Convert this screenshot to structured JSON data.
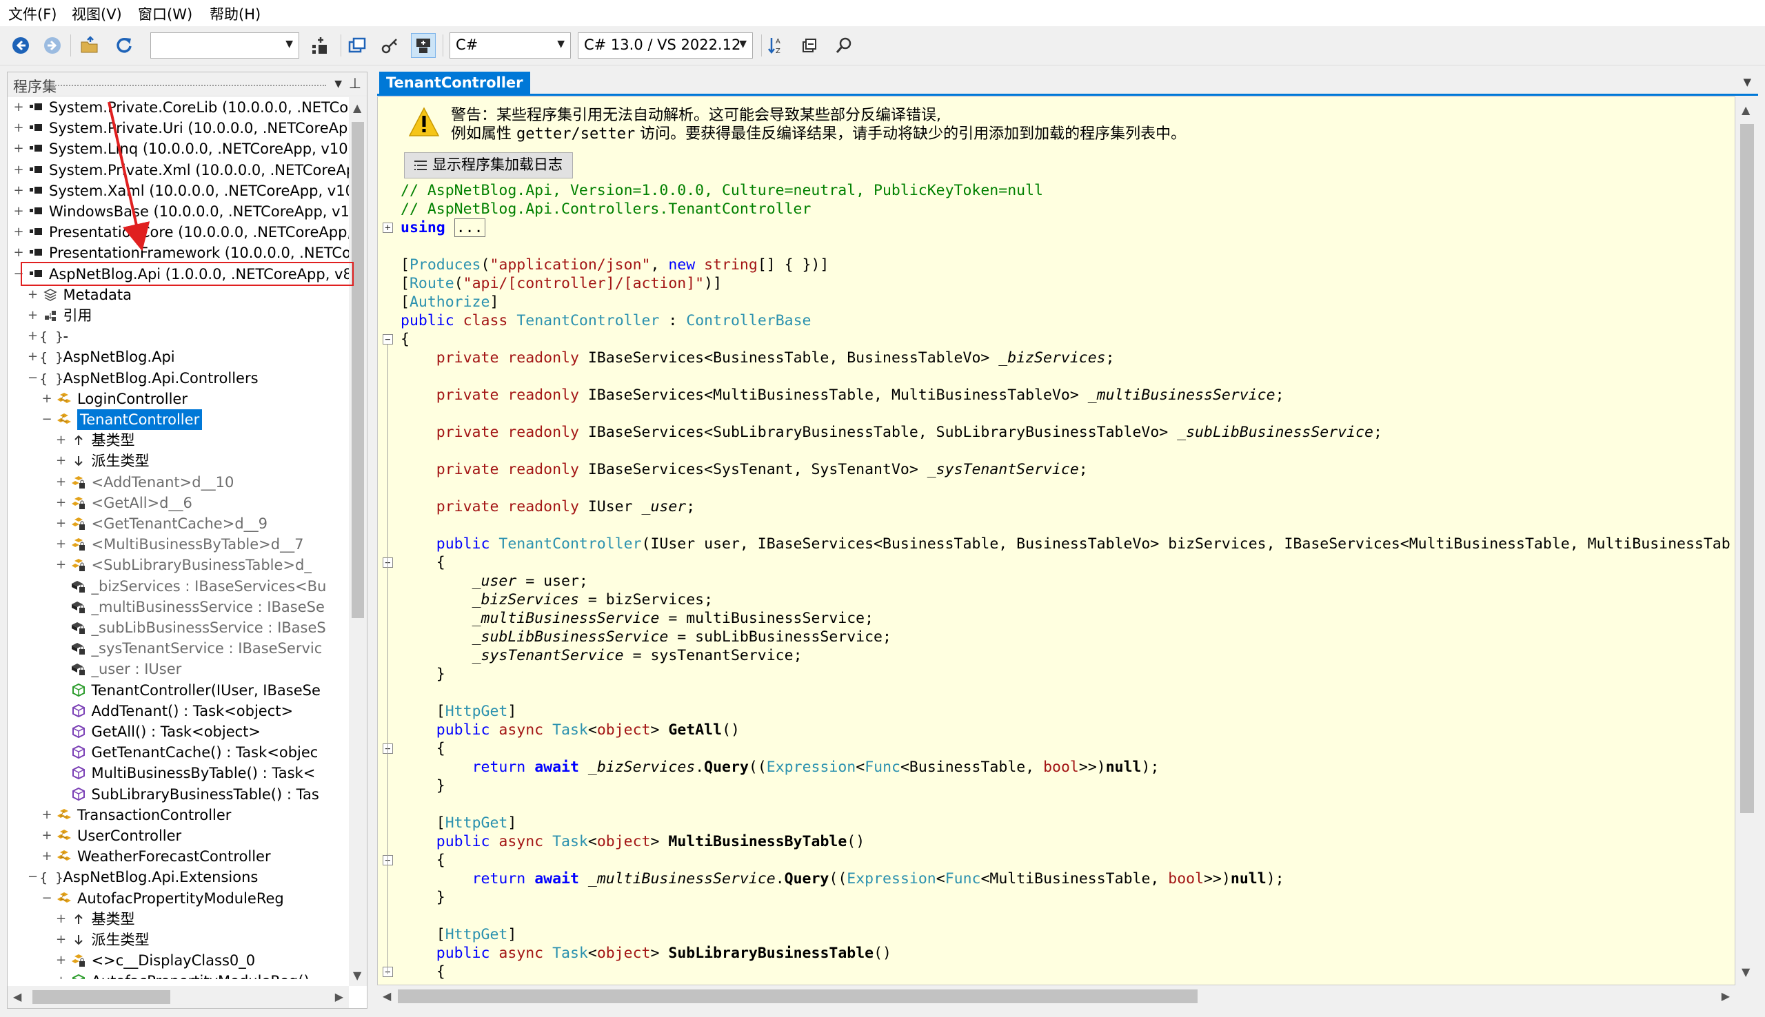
{
  "menu": [
    "文件(F)",
    "视图(V)",
    "窗口(W)",
    "帮助(H)"
  ],
  "toolbar": {
    "search_combo_value": "",
    "language": "C#",
    "language_version": "C# 13.0 / VS 2022.12",
    "buttons": [
      "back-icon",
      "forward-icon",
      "open-icon",
      "reload-icon",
      "add-to-list-icon",
      "manage-lists-icon",
      "show-all-icon",
      "show-private-icon",
      "sort-icon",
      "collapse-icon",
      "search-icon"
    ]
  },
  "left": {
    "title": "程序集",
    "tree": [
      {
        "text": "System.Private.CoreLib (10.0.0.0, .NETCore",
        "icon": "assembly",
        "toggle": "+"
      },
      {
        "text": "System.Private.Uri (10.0.0.0, .NETCoreApp",
        "icon": "assembly",
        "toggle": "+"
      },
      {
        "text": "System.Linq (10.0.0.0, .NETCoreApp, v10.0",
        "icon": "assembly",
        "toggle": "+"
      },
      {
        "text": "System.Private.Xml (10.0.0.0, .NETCoreAp",
        "icon": "assembly",
        "toggle": "+"
      },
      {
        "text": "System.Xaml (10.0.0.0, .NETCoreApp, v10.",
        "icon": "assembly",
        "toggle": "+"
      },
      {
        "text": "WindowsBase (10.0.0.0, .NETCoreApp, v10",
        "icon": "assembly",
        "toggle": "+"
      },
      {
        "text": "PresentationCore (10.0.0.0, .NETCoreApp,",
        "icon": "assembly",
        "toggle": "+"
      },
      {
        "text": "PresentationFramework (10.0.0.0, .NETCo",
        "icon": "assembly",
        "toggle": "+"
      },
      {
        "text": "AspNetBlog.Api (1.0.0.0, .NETCoreApp, v8",
        "icon": "assembly",
        "toggle": "−"
      },
      {
        "text": "Metadata",
        "icon": "metadata",
        "toggle": "+"
      },
      {
        "text": "引用",
        "icon": "references",
        "toggle": "+"
      },
      {
        "text": "-",
        "icon": "namespace",
        "toggle": "+"
      },
      {
        "text": "AspNetBlog.Api",
        "icon": "namespace",
        "toggle": "+"
      },
      {
        "text": "AspNetBlog.Api.Controllers",
        "icon": "namespace",
        "toggle": "−"
      },
      {
        "text": "LoginController",
        "icon": "class",
        "toggle": "+"
      },
      {
        "text": "TenantController",
        "icon": "class",
        "toggle": "−"
      },
      {
        "text": "基类型",
        "icon": "base-types",
        "toggle": "+"
      },
      {
        "text": "派生类型",
        "icon": "derived-types",
        "toggle": "+"
      },
      {
        "text": "<AddTenant>d__10",
        "icon": "private-class",
        "toggle": "+"
      },
      {
        "text": "<GetAll>d__6",
        "icon": "private-class",
        "toggle": "+"
      },
      {
        "text": "<GetTenantCache>d__9",
        "icon": "private-class",
        "toggle": "+"
      },
      {
        "text": "<MultiBusinessByTable>d__7",
        "icon": "private-class",
        "toggle": "+"
      },
      {
        "text": "<SubLibraryBusinessTable>d_",
        "icon": "private-class",
        "toggle": "+"
      },
      {
        "text": "_bizServices : IBaseServices<Bu",
        "icon": "private-field",
        "toggle": ""
      },
      {
        "text": "_multiBusinessService : IBaseSe",
        "icon": "private-field",
        "toggle": ""
      },
      {
        "text": "_subLibBusinessService : IBaseS",
        "icon": "private-field",
        "toggle": ""
      },
      {
        "text": "_sysTenantService : IBaseServic",
        "icon": "private-field",
        "toggle": ""
      },
      {
        "text": "_user : IUser",
        "icon": "private-field",
        "toggle": ""
      },
      {
        "text": "TenantController(IUser, IBaseSe",
        "icon": "constructor",
        "toggle": ""
      },
      {
        "text": "AddTenant() : Task<object>",
        "icon": "method",
        "toggle": ""
      },
      {
        "text": "GetAll() : Task<object>",
        "icon": "method",
        "toggle": ""
      },
      {
        "text": "GetTenantCache() : Task<objec",
        "icon": "method",
        "toggle": ""
      },
      {
        "text": "MultiBusinessByTable() : Task<",
        "icon": "method",
        "toggle": ""
      },
      {
        "text": "SubLibraryBusinessTable() : Tas",
        "icon": "method",
        "toggle": ""
      },
      {
        "text": "TransactionController",
        "icon": "class",
        "toggle": "+"
      },
      {
        "text": "UserController",
        "icon": "class",
        "toggle": "+"
      },
      {
        "text": "WeatherForecastController",
        "icon": "class",
        "toggle": "+"
      },
      {
        "text": "AspNetBlog.Api.Extensions",
        "icon": "namespace",
        "toggle": "−"
      },
      {
        "text": "AutofacPropertityModuleReg",
        "icon": "class",
        "toggle": "−"
      },
      {
        "text": "基类型",
        "icon": "base-types",
        "toggle": "+"
      },
      {
        "text": "派生类型",
        "icon": "derived-types",
        "toggle": "+"
      },
      {
        "text": "<>c__DisplayClass0_0",
        "icon": "private-class",
        "toggle": "+"
      },
      {
        "text": "AutofacPropertityModuleReg()",
        "icon": "constructor",
        "toggle": "+"
      }
    ]
  },
  "right": {
    "tab_title": "TenantController",
    "warning_line1": "警告：某些程序集引用无法自动解析。这可能会导致某些部分反编译错误,",
    "warning_line2_prefix": "例如属性 ",
    "warning_line2_code": "getter/setter",
    "warning_line2_suffix": " 访问。要获得最佳反编译结果，请手动将缺少的引用添加到加载的程序集列表中。",
    "load_log_button": "显示程序集加载日志",
    "code_lines": [
      [
        {
          "t": "// AspNetBlog.Api, Version=1.0.0.0, Culture=neutral, PublicKeyToken=null",
          "c": "cm"
        }
      ],
      [
        {
          "t": "// AspNetBlog.Api.Controllers.TenantController",
          "c": "cm"
        }
      ],
      [
        {
          "t": "using",
          "c": "kwb"
        },
        {
          "t": " "
        },
        {
          "t": "...",
          "c": "boxed"
        }
      ],
      [],
      [
        {
          "t": "["
        },
        {
          "t": "Produces",
          "c": "ty"
        },
        {
          "t": "("
        },
        {
          "t": "\"application/json\"",
          "c": "st"
        },
        {
          "t": ", "
        },
        {
          "t": "new",
          "c": "kw"
        },
        {
          "t": " "
        },
        {
          "t": "string",
          "c": "st"
        },
        {
          "t": "[] { })]"
        }
      ],
      [
        {
          "t": "["
        },
        {
          "t": "Route",
          "c": "ty"
        },
        {
          "t": "("
        },
        {
          "t": "\"api/[controller]/[action]\"",
          "c": "st"
        },
        {
          "t": ")]"
        }
      ],
      [
        {
          "t": "["
        },
        {
          "t": "Authorize",
          "c": "ty"
        },
        {
          "t": "]"
        }
      ],
      [
        {
          "t": "public",
          "c": "kw"
        },
        {
          "t": " "
        },
        {
          "t": "class",
          "c": "st"
        },
        {
          "t": " "
        },
        {
          "t": "TenantController",
          "c": "ty"
        },
        {
          "t": " : "
        },
        {
          "t": "ControllerBase",
          "c": "ty"
        }
      ],
      [
        {
          "t": "{"
        }
      ],
      [
        {
          "t": "    "
        },
        {
          "t": "private",
          "c": "st"
        },
        {
          "t": " "
        },
        {
          "t": "readonly",
          "c": "st"
        },
        {
          "t": " IBaseServices<BusinessTable, BusinessTableVo> "
        },
        {
          "t": "_bizServices",
          "c": "fld"
        },
        {
          "t": ";"
        }
      ],
      [],
      [
        {
          "t": "    "
        },
        {
          "t": "private",
          "c": "st"
        },
        {
          "t": " "
        },
        {
          "t": "readonly",
          "c": "st"
        },
        {
          "t": " IBaseServices<MultiBusinessTable, MultiBusinessTableVo> "
        },
        {
          "t": "_multiBusinessService",
          "c": "fld"
        },
        {
          "t": ";"
        }
      ],
      [],
      [
        {
          "t": "    "
        },
        {
          "t": "private",
          "c": "st"
        },
        {
          "t": " "
        },
        {
          "t": "readonly",
          "c": "st"
        },
        {
          "t": " IBaseServices<SubLibraryBusinessTable, SubLibraryBusinessTableVo> "
        },
        {
          "t": "_subLibBusinessService",
          "c": "fld"
        },
        {
          "t": ";"
        }
      ],
      [],
      [
        {
          "t": "    "
        },
        {
          "t": "private",
          "c": "st"
        },
        {
          "t": " "
        },
        {
          "t": "readonly",
          "c": "st"
        },
        {
          "t": " IBaseServices<SysTenant, SysTenantVo> "
        },
        {
          "t": "_sysTenantService",
          "c": "fld"
        },
        {
          "t": ";"
        }
      ],
      [],
      [
        {
          "t": "    "
        },
        {
          "t": "private",
          "c": "st"
        },
        {
          "t": " "
        },
        {
          "t": "readonly",
          "c": "st"
        },
        {
          "t": " IUser "
        },
        {
          "t": "_user",
          "c": "fld"
        },
        {
          "t": ";"
        }
      ],
      [],
      [
        {
          "t": "    "
        },
        {
          "t": "public",
          "c": "kw"
        },
        {
          "t": " "
        },
        {
          "t": "TenantController",
          "c": "ty"
        },
        {
          "t": "(IUser user, IBaseServices<BusinessTable, BusinessTableVo> bizServices, IBaseServices<MultiBusinessTable, MultiBusinessTab"
        }
      ],
      [
        {
          "t": "    {"
        }
      ],
      [
        {
          "t": "        "
        },
        {
          "t": "_user",
          "c": "fld"
        },
        {
          "t": " = user;"
        }
      ],
      [
        {
          "t": "        "
        },
        {
          "t": "_bizServices",
          "c": "fld"
        },
        {
          "t": " = bizServices;"
        }
      ],
      [
        {
          "t": "        "
        },
        {
          "t": "_multiBusinessService",
          "c": "fld"
        },
        {
          "t": " = multiBusinessService;"
        }
      ],
      [
        {
          "t": "        "
        },
        {
          "t": "_subLibBusinessService",
          "c": "fld"
        },
        {
          "t": " = subLibBusinessService;"
        }
      ],
      [
        {
          "t": "        "
        },
        {
          "t": "_sysTenantService",
          "c": "fld"
        },
        {
          "t": " = sysTenantService;"
        }
      ],
      [
        {
          "t": "    }"
        }
      ],
      [],
      [
        {
          "t": "    ["
        },
        {
          "t": "HttpGet",
          "c": "ty"
        },
        {
          "t": "]"
        }
      ],
      [
        {
          "t": "    "
        },
        {
          "t": "public",
          "c": "kw"
        },
        {
          "t": " "
        },
        {
          "t": "async",
          "c": "st"
        },
        {
          "t": " "
        },
        {
          "t": "Task",
          "c": "ty"
        },
        {
          "t": "<"
        },
        {
          "t": "object",
          "c": "st"
        },
        {
          "t": "> "
        },
        {
          "t": "GetAll",
          "c": "bold"
        },
        {
          "t": "()"
        }
      ],
      [
        {
          "t": "    {"
        }
      ],
      [
        {
          "t": "        "
        },
        {
          "t": "return",
          "c": "kw"
        },
        {
          "t": " "
        },
        {
          "t": "await",
          "c": "kwb"
        },
        {
          "t": " "
        },
        {
          "t": "_bizServices",
          "c": "fld"
        },
        {
          "t": "."
        },
        {
          "t": "Query",
          "c": "bold"
        },
        {
          "t": "(("
        },
        {
          "t": "Expression",
          "c": "ty"
        },
        {
          "t": "<"
        },
        {
          "t": "Func",
          "c": "ty"
        },
        {
          "t": "<BusinessTable, "
        },
        {
          "t": "bool",
          "c": "st"
        },
        {
          "t": ">>)"
        },
        {
          "t": "null",
          "c": "bold"
        },
        {
          "t": ");"
        }
      ],
      [
        {
          "t": "    }"
        }
      ],
      [],
      [
        {
          "t": "    ["
        },
        {
          "t": "HttpGet",
          "c": "ty"
        },
        {
          "t": "]"
        }
      ],
      [
        {
          "t": "    "
        },
        {
          "t": "public",
          "c": "kw"
        },
        {
          "t": " "
        },
        {
          "t": "async",
          "c": "st"
        },
        {
          "t": " "
        },
        {
          "t": "Task",
          "c": "ty"
        },
        {
          "t": "<"
        },
        {
          "t": "object",
          "c": "st"
        },
        {
          "t": "> "
        },
        {
          "t": "MultiBusinessByTable",
          "c": "bold"
        },
        {
          "t": "()"
        }
      ],
      [
        {
          "t": "    {"
        }
      ],
      [
        {
          "t": "        "
        },
        {
          "t": "return",
          "c": "kw"
        },
        {
          "t": " "
        },
        {
          "t": "await",
          "c": "kwb"
        },
        {
          "t": " "
        },
        {
          "t": "_multiBusinessService",
          "c": "fld"
        },
        {
          "t": "."
        },
        {
          "t": "Query",
          "c": "bold"
        },
        {
          "t": "(("
        },
        {
          "t": "Expression",
          "c": "ty"
        },
        {
          "t": "<"
        },
        {
          "t": "Func",
          "c": "ty"
        },
        {
          "t": "<MultiBusinessTable, "
        },
        {
          "t": "bool",
          "c": "st"
        },
        {
          "t": ">>)"
        },
        {
          "t": "null",
          "c": "bold"
        },
        {
          "t": ");"
        }
      ],
      [
        {
          "t": "    }"
        }
      ],
      [],
      [
        {
          "t": "    ["
        },
        {
          "t": "HttpGet",
          "c": "ty"
        },
        {
          "t": "]"
        }
      ],
      [
        {
          "t": "    "
        },
        {
          "t": "public",
          "c": "kw"
        },
        {
          "t": " "
        },
        {
          "t": "async",
          "c": "st"
        },
        {
          "t": " "
        },
        {
          "t": "Task",
          "c": "ty"
        },
        {
          "t": "<"
        },
        {
          "t": "object",
          "c": "st"
        },
        {
          "t": "> "
        },
        {
          "t": "SubLibraryBusinessTable",
          "c": "bold"
        },
        {
          "t": "()"
        }
      ],
      [
        {
          "t": "    {"
        }
      ]
    ]
  }
}
